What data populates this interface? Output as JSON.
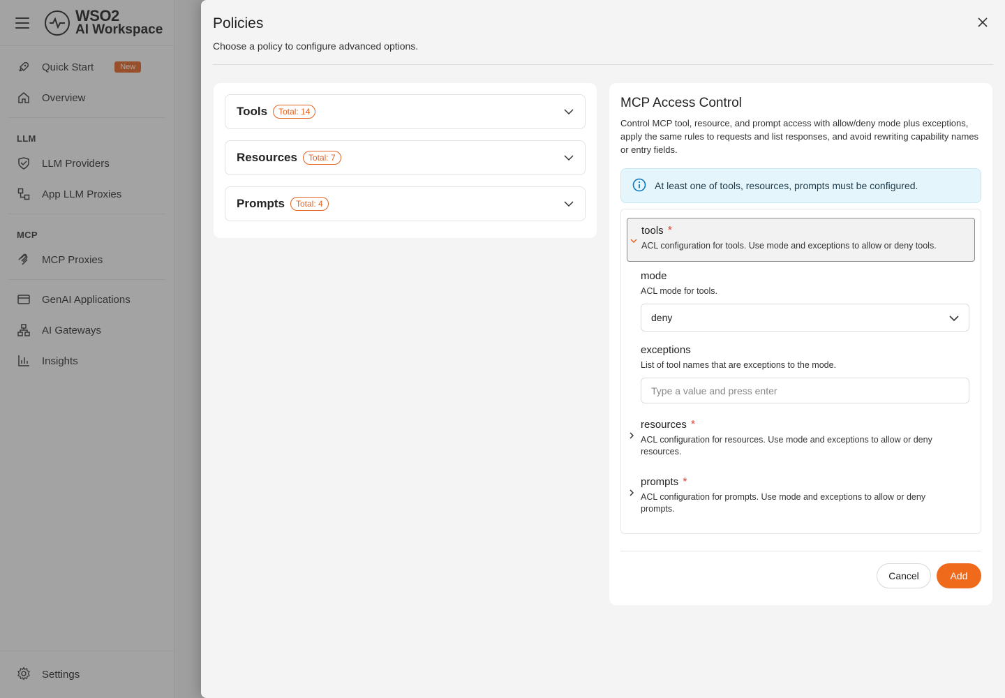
{
  "app": {
    "logo_line1": "WSO2",
    "logo_line2": "AI Workspace"
  },
  "sidebar": {
    "quick_start": "Quick Start",
    "new_badge": "New",
    "overview": "Overview",
    "llm_section": "LLM",
    "llm_providers": "LLM Providers",
    "app_llm_proxies": "App LLM Proxies",
    "mcp_section": "MCP",
    "mcp_proxies": "MCP Proxies",
    "genai_applications": "GenAI Applications",
    "ai_gateways": "AI Gateways",
    "insights": "Insights",
    "settings": "Settings"
  },
  "drawer": {
    "title": "Policies",
    "subtitle": "Choose a policy to configure advanced options."
  },
  "policy_groups": [
    {
      "name": "Tools",
      "total": "Total: 14"
    },
    {
      "name": "Resources",
      "total": "Total: 7"
    },
    {
      "name": "Prompts",
      "total": "Total: 4"
    }
  ],
  "config": {
    "title": "MCP Access Control",
    "description": "Control MCP tool, resource, and prompt access with allow/deny mode plus exceptions, apply the same rules to requests and list responses, and avoid rewriting capability names or entry fields.",
    "info": "At least one of tools, resources, prompts must be configured.",
    "tools": {
      "label": "tools",
      "required": "*",
      "desc": "ACL configuration for tools. Use mode and exceptions to allow or deny tools.",
      "mode_label": "mode",
      "mode_desc": "ACL mode for tools.",
      "mode_value": "deny",
      "exceptions_label": "exceptions",
      "exceptions_desc": "List of tool names that are exceptions to the mode.",
      "exceptions_placeholder": "Type a value and press enter"
    },
    "resources": {
      "label": "resources",
      "required": "*",
      "desc": "ACL configuration for resources. Use mode and exceptions to allow or deny resources."
    },
    "prompts": {
      "label": "prompts",
      "required": "*",
      "desc": "ACL configuration for prompts. Use mode and exceptions to allow or deny prompts."
    },
    "cancel": "Cancel",
    "add": "Add"
  },
  "colors": {
    "accent": "#f06a1c",
    "info_bg": "#e4f5fb"
  }
}
